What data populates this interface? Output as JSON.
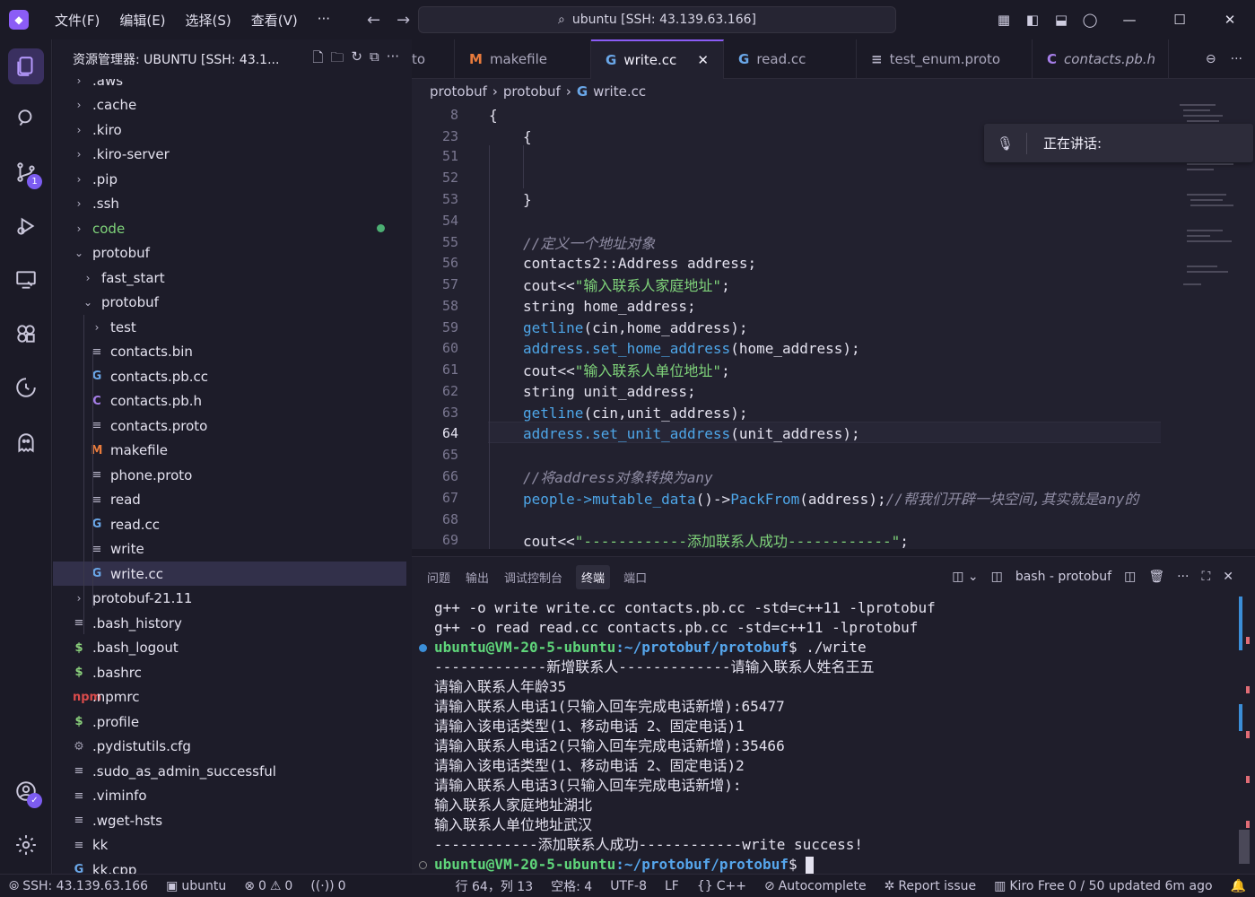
{
  "titlebar": {
    "menu": [
      "文件(F)",
      "编辑(E)",
      "选择(S)",
      "查看(V)",
      "···"
    ],
    "search_text": "ubuntu [SSH: 43.139.63.166]"
  },
  "sidebar": {
    "title": "资源管理器: UBUNTU [SSH: 43.1...",
    "tree": [
      {
        "label": ".aws",
        "kind": "folder",
        "depth": 0,
        "expanded": false
      },
      {
        "label": ".cache",
        "kind": "folder",
        "depth": 0,
        "expanded": false
      },
      {
        "label": ".kiro",
        "kind": "folder",
        "depth": 0,
        "expanded": false
      },
      {
        "label": ".kiro-server",
        "kind": "folder",
        "depth": 0,
        "expanded": false
      },
      {
        "label": ".pip",
        "kind": "folder",
        "depth": 0,
        "expanded": false
      },
      {
        "label": ".ssh",
        "kind": "folder",
        "depth": 0,
        "expanded": false
      },
      {
        "label": "code",
        "kind": "folder",
        "depth": 0,
        "expanded": false,
        "modified": true
      },
      {
        "label": "protobuf",
        "kind": "folder",
        "depth": 0,
        "expanded": true
      },
      {
        "label": "fast_start",
        "kind": "folder",
        "depth": 1,
        "expanded": false
      },
      {
        "label": "protobuf",
        "kind": "folder",
        "depth": 1,
        "expanded": true
      },
      {
        "label": "test",
        "kind": "folder",
        "depth": 2,
        "expanded": false
      },
      {
        "label": "contacts.bin",
        "kind": "file",
        "icon": "txt",
        "depth": 2
      },
      {
        "label": "contacts.pb.cc",
        "kind": "file",
        "icon": "cpp",
        "depth": 2
      },
      {
        "label": "contacts.pb.h",
        "kind": "file",
        "icon": "h",
        "depth": 2
      },
      {
        "label": "contacts.proto",
        "kind": "file",
        "icon": "txt",
        "depth": 2
      },
      {
        "label": "makefile",
        "kind": "file",
        "icon": "m",
        "depth": 2
      },
      {
        "label": "phone.proto",
        "kind": "file",
        "icon": "txt",
        "depth": 2
      },
      {
        "label": "read",
        "kind": "file",
        "icon": "txt",
        "depth": 2
      },
      {
        "label": "read.cc",
        "kind": "file",
        "icon": "cpp",
        "depth": 2
      },
      {
        "label": "write",
        "kind": "file",
        "icon": "txt",
        "depth": 2
      },
      {
        "label": "write.cc",
        "kind": "file",
        "icon": "cpp",
        "depth": 2,
        "selected": true
      },
      {
        "label": "protobuf-21.11",
        "kind": "folder",
        "depth": 0,
        "expanded": false
      },
      {
        "label": ".bash_history",
        "kind": "file",
        "icon": "txt",
        "depth": 0
      },
      {
        "label": ".bash_logout",
        "kind": "file",
        "icon": "dollar",
        "depth": 0
      },
      {
        "label": ".bashrc",
        "kind": "file",
        "icon": "dollar",
        "depth": 0
      },
      {
        "label": ".npmrc",
        "kind": "file",
        "icon": "npm",
        "depth": 0
      },
      {
        "label": ".profile",
        "kind": "file",
        "icon": "dollar",
        "depth": 0
      },
      {
        "label": ".pydistutils.cfg",
        "kind": "file",
        "icon": "gear",
        "depth": 0
      },
      {
        "label": ".sudo_as_admin_successful",
        "kind": "file",
        "icon": "txt",
        "depth": 0
      },
      {
        "label": ".viminfo",
        "kind": "file",
        "icon": "txt",
        "depth": 0
      },
      {
        "label": ".wget-hsts",
        "kind": "file",
        "icon": "txt",
        "depth": 0
      },
      {
        "label": "kk",
        "kind": "file",
        "icon": "txt",
        "depth": 0
      },
      {
        "label": "kk.cpp",
        "kind": "file",
        "icon": "cpp",
        "depth": 0
      }
    ]
  },
  "tabs": [
    {
      "label": "to",
      "icon": ""
    },
    {
      "label": "makefile",
      "icon": "M"
    },
    {
      "label": "write.cc",
      "icon": "G",
      "active": true
    },
    {
      "label": "read.cc",
      "icon": "G"
    },
    {
      "label": "test_enum.proto",
      "icon": "≡"
    },
    {
      "label": "contacts.pb.h",
      "icon": "C"
    }
  ],
  "breadcrumb": [
    "protobuf",
    "protobuf",
    "write.cc"
  ],
  "code": [
    {
      "n": "8",
      "indent": 0,
      "parts": [
        [
          "t",
          "{"
        ]
      ]
    },
    {
      "n": "23",
      "indent": 1,
      "parts": [
        [
          "t",
          "{"
        ]
      ]
    },
    {
      "n": "51",
      "indent": 2,
      "parts": []
    },
    {
      "n": "52",
      "indent": 2,
      "parts": []
    },
    {
      "n": "53",
      "indent": 1,
      "parts": [
        [
          "t",
          "}"
        ]
      ]
    },
    {
      "n": "54",
      "indent": 1,
      "parts": []
    },
    {
      "n": "55",
      "indent": 1,
      "parts": [
        [
          "c",
          "//定义一个地址对象"
        ]
      ]
    },
    {
      "n": "56",
      "indent": 1,
      "parts": [
        [
          "t",
          "contacts2::Address address;"
        ]
      ]
    },
    {
      "n": "57",
      "indent": 1,
      "parts": [
        [
          "t",
          "cout<<"
        ],
        [
          "s",
          "\"输入联系人家庭地址\""
        ],
        [
          "t",
          ";"
        ]
      ]
    },
    {
      "n": "58",
      "indent": 1,
      "parts": [
        [
          "t",
          "string home_address;"
        ]
      ]
    },
    {
      "n": "59",
      "indent": 1,
      "parts": [
        [
          "f",
          "getline"
        ],
        [
          "t",
          "(cin,home_address);"
        ]
      ]
    },
    {
      "n": "60",
      "indent": 1,
      "parts": [
        [
          "f",
          "address.set_home_address"
        ],
        [
          "t",
          "(home_address);"
        ]
      ]
    },
    {
      "n": "61",
      "indent": 1,
      "parts": [
        [
          "t",
          "cout<<"
        ],
        [
          "s",
          "\"输入联系人单位地址\""
        ],
        [
          "t",
          ";"
        ]
      ]
    },
    {
      "n": "62",
      "indent": 1,
      "parts": [
        [
          "t",
          "string unit_address;"
        ]
      ]
    },
    {
      "n": "63",
      "indent": 1,
      "parts": [
        [
          "f",
          "getline"
        ],
        [
          "t",
          "(cin,unit_address);"
        ]
      ]
    },
    {
      "n": "64",
      "indent": 1,
      "parts": [
        [
          "f",
          "address.set_unit_address"
        ],
        [
          "t",
          "(unit_address);"
        ]
      ],
      "current": true
    },
    {
      "n": "65",
      "indent": 1,
      "parts": []
    },
    {
      "n": "66",
      "indent": 1,
      "parts": [
        [
          "c",
          "//将address对象转换为any"
        ]
      ]
    },
    {
      "n": "67",
      "indent": 1,
      "parts": [
        [
          "f",
          "people->mutable_data"
        ],
        [
          "t",
          "()->"
        ],
        [
          "f",
          "PackFrom"
        ],
        [
          "t",
          "(address);"
        ],
        [
          "c",
          "//帮我们开辟一块空间,其实就是any的"
        ]
      ]
    },
    {
      "n": "68",
      "indent": 1,
      "parts": []
    },
    {
      "n": "69",
      "indent": 1,
      "parts": [
        [
          "t",
          "cout<<"
        ],
        [
          "s",
          "\"------------添加联系人成功------------\""
        ],
        [
          "t",
          ";"
        ]
      ]
    }
  ],
  "notification": {
    "text": "正在讲话:"
  },
  "panel": {
    "tabs": [
      "问题",
      "输出",
      "调试控制台",
      "终端",
      "端口"
    ],
    "active_tab": "终端",
    "terminal_name": "bash - protobuf"
  },
  "terminal": {
    "lines": [
      {
        "text": "g++ -o write write.cc contacts.pb.cc -std=c++11 -lprotobuf"
      },
      {
        "text": "g++ -o read read.cc contacts.pb.cc -std=c++11 -lprotobuf"
      },
      {
        "prompt_user": "ubuntu@VM-20-5-ubuntu",
        "prompt_path": ":~/protobuf/protobuf",
        "cmd": "$ ./write",
        "dot": "#3b8ed8"
      },
      {
        "text": "-------------新增联系人-------------请输入联系人姓名王五"
      },
      {
        "text": "请输入联系人年龄35"
      },
      {
        "text": "请输入联系人电话1(只输入回车完成电话新增):65477"
      },
      {
        "text": "请输入该电话类型(1、移动电话 2、固定电话)1"
      },
      {
        "text": "请输入联系人电话2(只输入回车完成电话新增):35466"
      },
      {
        "text": "请输入该电话类型(1、移动电话 2、固定电话)2"
      },
      {
        "text": "请输入联系人电话3(只输入回车完成电话新增):"
      },
      {
        "text": "输入联系人家庭地址湖北"
      },
      {
        "text": "输入联系人单位地址武汉"
      },
      {
        "text": "------------添加联系人成功------------write success!"
      },
      {
        "prompt_user": "ubuntu@VM-20-5-ubuntu",
        "prompt_path": ":~/protobuf/protobuf",
        "cmd": "$ ",
        "dot": "#777",
        "cursor": true
      }
    ]
  },
  "statusbar": {
    "remote": "SSH: 43.139.63.166",
    "branch": "ubuntu",
    "errors": "0",
    "warnings": "0",
    "ports": "0",
    "position": "行 64，列 13",
    "spaces": "空格: 4",
    "encoding": "UTF-8",
    "eol": "LF",
    "language": "C++",
    "autocomplete": "Autocomplete",
    "report": "Report issue",
    "kiro": "Kiro Free 0 / 50 updated 6m ago"
  },
  "colors": {
    "accent": "#8b5cf6",
    "string": "#7fd37a",
    "function": "#4ea6e8",
    "comment": "#8f8ca3"
  }
}
